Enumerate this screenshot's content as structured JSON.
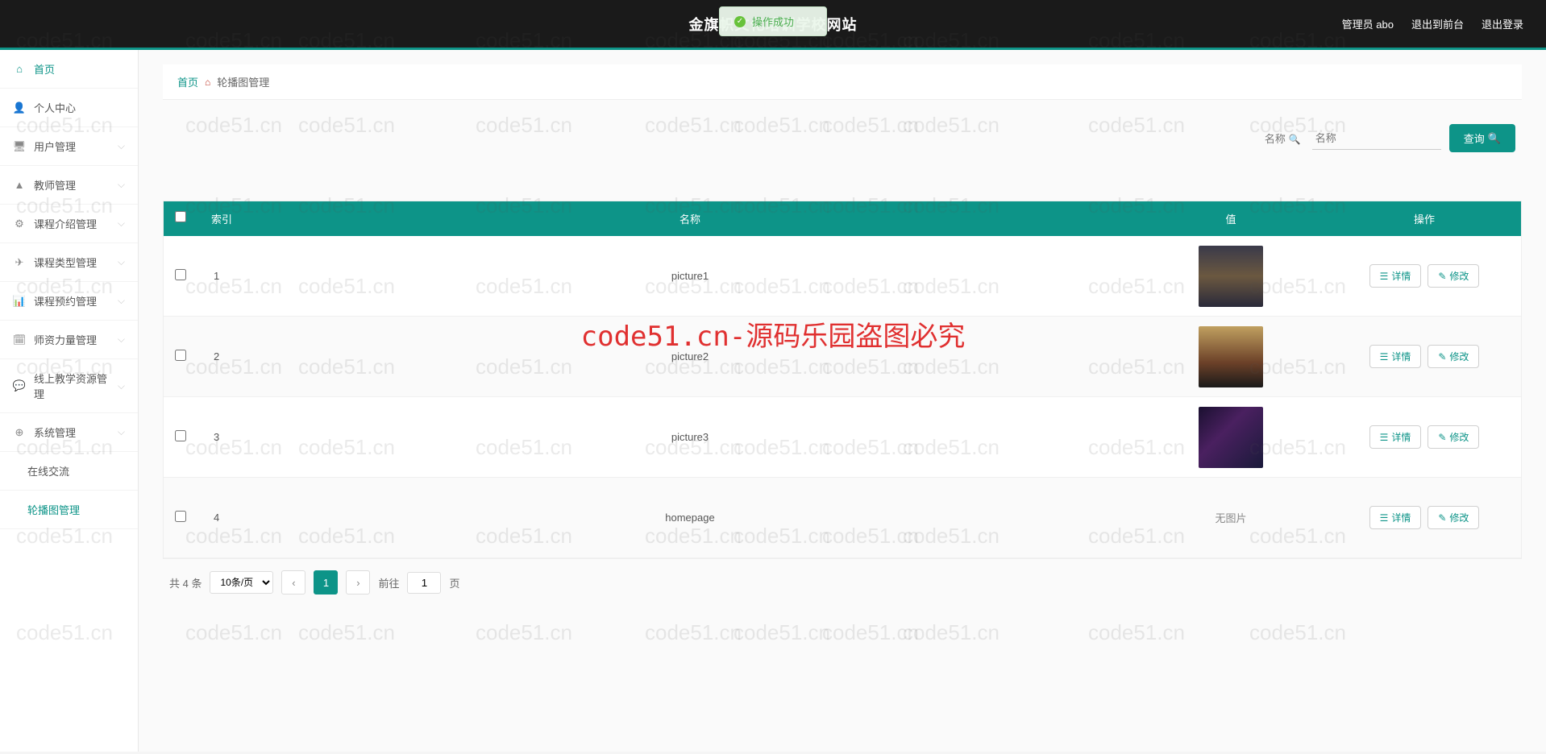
{
  "toast": {
    "text": "操作成功"
  },
  "header": {
    "title": "金旗帜文化培训学校网站",
    "user_label": "管理员 abo",
    "exit_front": "退出到前台",
    "logout": "退出登录"
  },
  "sidebar": {
    "items": [
      {
        "label": "首页",
        "icon": "home",
        "expandable": false
      },
      {
        "label": "个人中心",
        "icon": "user",
        "expandable": false
      },
      {
        "label": "用户管理",
        "icon": "monitor",
        "expandable": true
      },
      {
        "label": "教师管理",
        "icon": "person",
        "expandable": true
      },
      {
        "label": "课程介绍管理",
        "icon": "gear",
        "expandable": true
      },
      {
        "label": "课程类型管理",
        "icon": "send",
        "expandable": true
      },
      {
        "label": "课程预约管理",
        "icon": "bars",
        "expandable": true
      },
      {
        "label": "师资力量管理",
        "icon": "calendar",
        "expandable": true
      },
      {
        "label": "线上教学资源管理",
        "icon": "chat",
        "expandable": true
      },
      {
        "label": "系统管理",
        "icon": "globe",
        "expandable": true
      }
    ],
    "subs": [
      {
        "label": "在线交流",
        "active": false
      },
      {
        "label": "轮播图管理",
        "active": true
      }
    ]
  },
  "breadcrumb": {
    "home": "首页",
    "current": "轮播图管理"
  },
  "search": {
    "label": "名称",
    "placeholder": "名称",
    "query_btn": "查询"
  },
  "table": {
    "headers": {
      "index": "索引",
      "name": "名称",
      "value": "值",
      "actions": "操作"
    },
    "rows": [
      {
        "idx": "1",
        "name": "picture1",
        "has_image": true,
        "img_class": "c1"
      },
      {
        "idx": "2",
        "name": "picture2",
        "has_image": true,
        "img_class": "c2"
      },
      {
        "idx": "3",
        "name": "picture3",
        "has_image": true,
        "img_class": "c3"
      },
      {
        "idx": "4",
        "name": "homepage",
        "has_image": false,
        "no_image_text": "无图片"
      }
    ],
    "detail_btn": "详情",
    "edit_btn": "修改"
  },
  "pager": {
    "total": "共 4 条",
    "per_page": "10条/页",
    "current": "1",
    "goto_prefix": "前往",
    "goto_value": "1",
    "goto_suffix": "页"
  },
  "watermark": "code51.cn",
  "center_watermark": "code51.cn-源码乐园盗图必究"
}
